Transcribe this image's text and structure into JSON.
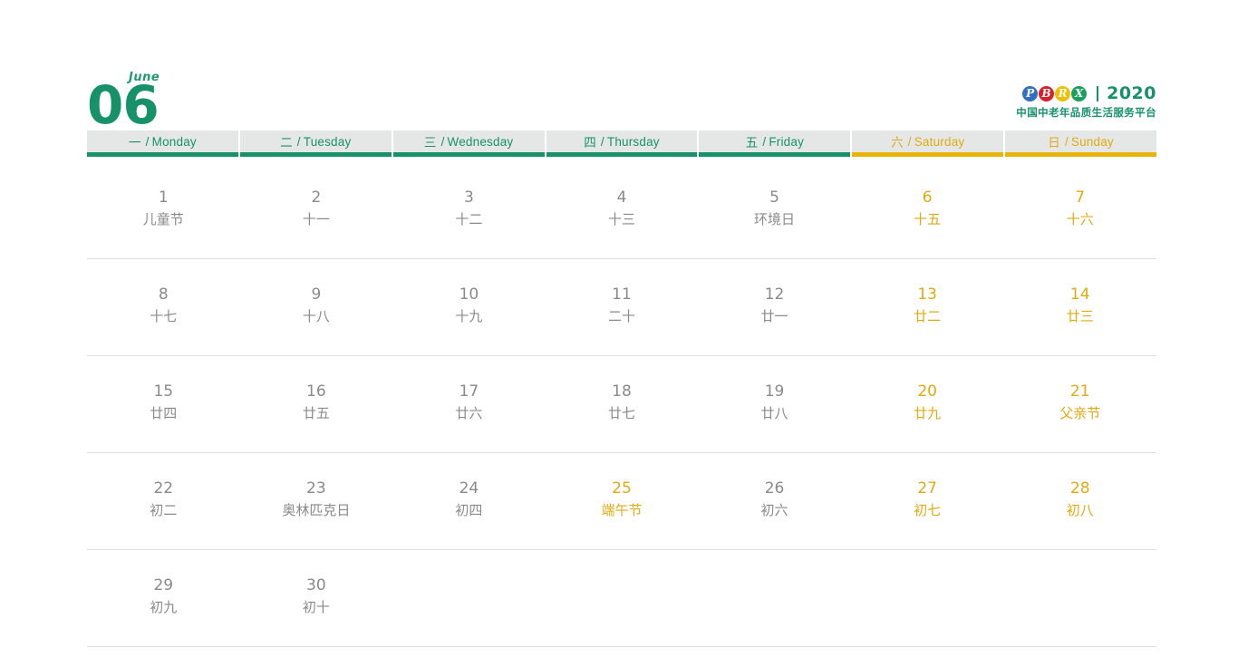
{
  "header": {
    "month_label": "June",
    "month_number": "06",
    "brand": {
      "logo_letters": [
        "P",
        "B",
        "R",
        "X"
      ],
      "logo_colors": [
        "#2f6fc4",
        "#d8202a",
        "#f0c000",
        "#18a05c"
      ],
      "year": "2020",
      "tagline": "中国中老年品质生活服务平台"
    }
  },
  "colors": {
    "green": "#179268",
    "gold": "#e0aa10",
    "gray_text": "#8a8a8a",
    "head_bg": "#e4e7e6",
    "rule": "#dfdfdf"
  },
  "weekdays": [
    {
      "cn": "一",
      "en": "Monday",
      "weekend": false
    },
    {
      "cn": "二",
      "en": "Tuesday",
      "weekend": false
    },
    {
      "cn": "三",
      "en": "Wednesday",
      "weekend": false
    },
    {
      "cn": "四",
      "en": "Thursday",
      "weekend": false
    },
    {
      "cn": "五",
      "en": "Friday",
      "weekend": false
    },
    {
      "cn": "六",
      "en": "Saturday",
      "weekend": true
    },
    {
      "cn": "日",
      "en": "Sunday",
      "weekend": true
    }
  ],
  "weeks": [
    [
      {
        "num": "1",
        "sub": "儿童节",
        "gold": false
      },
      {
        "num": "2",
        "sub": "十一",
        "gold": false
      },
      {
        "num": "3",
        "sub": "十二",
        "gold": false
      },
      {
        "num": "4",
        "sub": "十三",
        "gold": false
      },
      {
        "num": "5",
        "sub": "环境日",
        "gold": false
      },
      {
        "num": "6",
        "sub": "十五",
        "gold": true
      },
      {
        "num": "7",
        "sub": "十六",
        "gold": true
      }
    ],
    [
      {
        "num": "8",
        "sub": "十七",
        "gold": false
      },
      {
        "num": "9",
        "sub": "十八",
        "gold": false
      },
      {
        "num": "10",
        "sub": "十九",
        "gold": false
      },
      {
        "num": "11",
        "sub": "二十",
        "gold": false
      },
      {
        "num": "12",
        "sub": "廿一",
        "gold": false
      },
      {
        "num": "13",
        "sub": "廿二",
        "gold": true
      },
      {
        "num": "14",
        "sub": "廿三",
        "gold": true
      }
    ],
    [
      {
        "num": "15",
        "sub": "廿四",
        "gold": false
      },
      {
        "num": "16",
        "sub": "廿五",
        "gold": false
      },
      {
        "num": "17",
        "sub": "廿六",
        "gold": false
      },
      {
        "num": "18",
        "sub": "廿七",
        "gold": false
      },
      {
        "num": "19",
        "sub": "廿八",
        "gold": false
      },
      {
        "num": "20",
        "sub": "廿九",
        "gold": true
      },
      {
        "num": "21",
        "sub": "父亲节",
        "gold": true
      }
    ],
    [
      {
        "num": "22",
        "sub": "初二",
        "gold": false
      },
      {
        "num": "23",
        "sub": "奥林匹克日",
        "gold": false
      },
      {
        "num": "24",
        "sub": "初四",
        "gold": false
      },
      {
        "num": "25",
        "sub": "端午节",
        "gold": true
      },
      {
        "num": "26",
        "sub": "初六",
        "gold": false
      },
      {
        "num": "27",
        "sub": "初七",
        "gold": true
      },
      {
        "num": "28",
        "sub": "初八",
        "gold": true
      }
    ],
    [
      {
        "num": "29",
        "sub": "初九",
        "gold": false
      },
      {
        "num": "30",
        "sub": "初十",
        "gold": false
      },
      {
        "num": "",
        "sub": "",
        "gold": false
      },
      {
        "num": "",
        "sub": "",
        "gold": false
      },
      {
        "num": "",
        "sub": "",
        "gold": false
      },
      {
        "num": "",
        "sub": "",
        "gold": false
      },
      {
        "num": "",
        "sub": "",
        "gold": false
      }
    ]
  ]
}
